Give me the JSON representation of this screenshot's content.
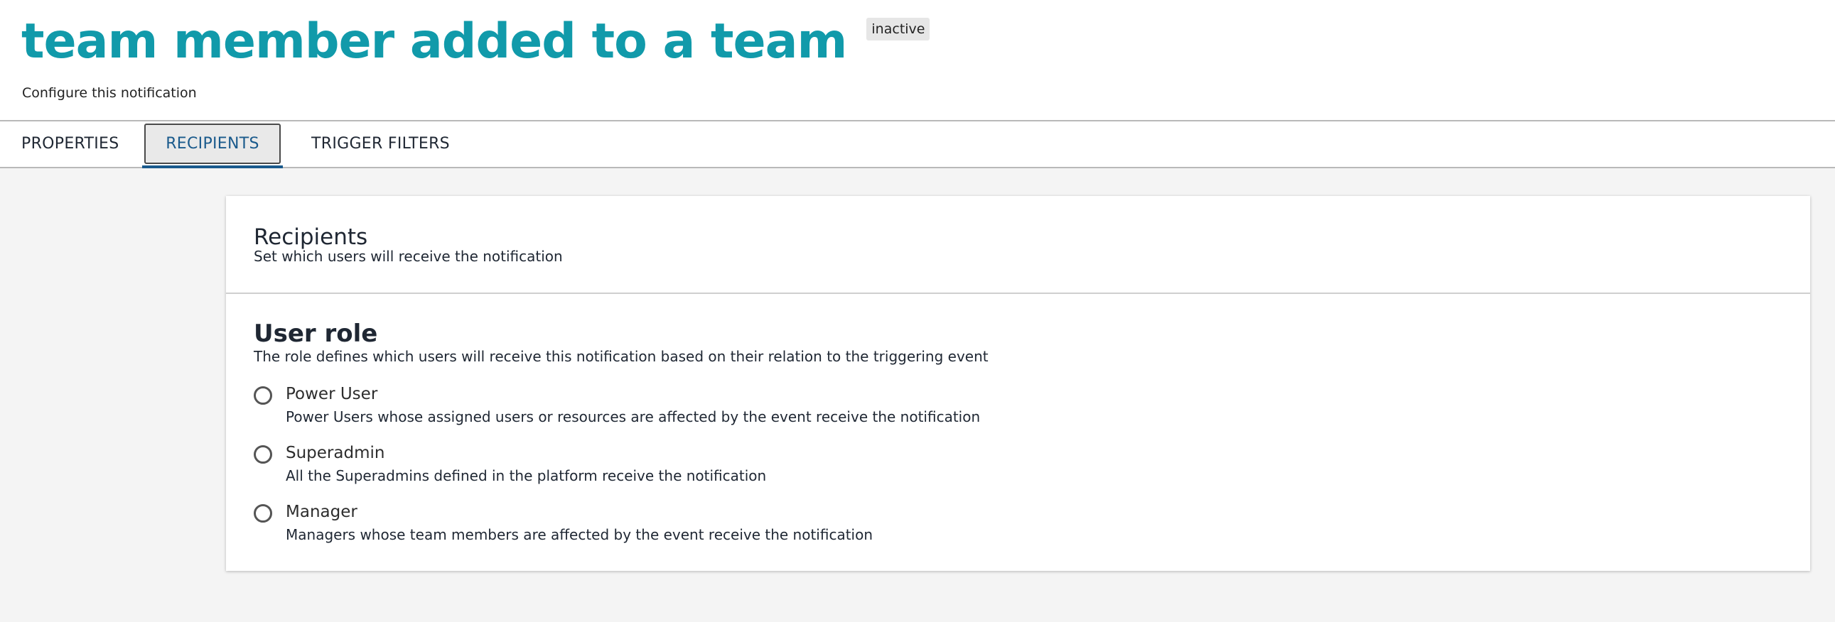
{
  "header": {
    "title": "team member added to a team",
    "status": "inactive",
    "subtitle": "Configure this notification"
  },
  "tabs": [
    {
      "label": "PROPERTIES",
      "active": false
    },
    {
      "label": "RECIPIENTS",
      "active": true
    },
    {
      "label": "TRIGGER FILTERS",
      "active": false
    }
  ],
  "recipients": {
    "title": "Recipients",
    "description": "Set which users will receive the notification"
  },
  "user_role": {
    "title": "User role",
    "description": "The role defines which users will receive this notification based on their relation to the triggering event",
    "options": [
      {
        "label": "Power User",
        "description": "Power Users whose assigned users or resources are affected by the event receive the notification",
        "selected": false
      },
      {
        "label": "Superadmin",
        "description": "All the Superadmins defined in the platform receive the notification",
        "selected": false
      },
      {
        "label": "Manager",
        "description": "Managers whose team members are affected by the event receive the notification",
        "selected": false
      }
    ]
  },
  "colors": {
    "title": "#119aaa",
    "active_tab": "#1a5a8c",
    "background": "#f4f4f4"
  }
}
